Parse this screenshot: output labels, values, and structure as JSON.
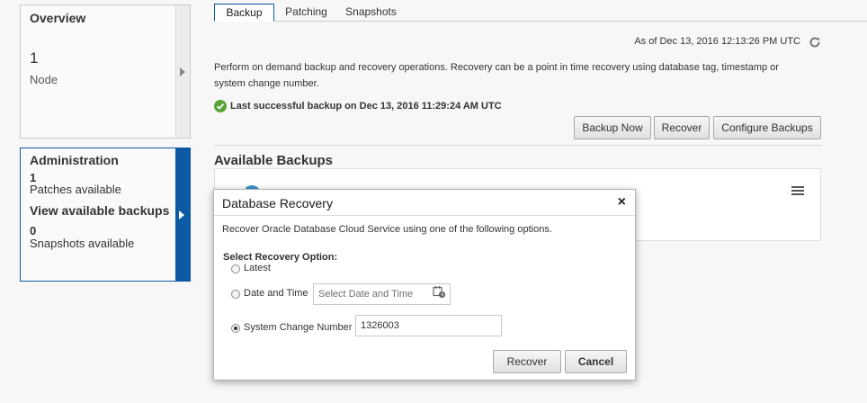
{
  "overview": {
    "title": "Overview",
    "count": "1",
    "label": "Node"
  },
  "admin": {
    "title": "Administration",
    "patches_count": "1",
    "patches_label": "Patches available",
    "backups_link": "View available backups",
    "snapshots_count": "0",
    "snapshots_label": "Snapshots available"
  },
  "tabs": [
    "Backup",
    "Patching",
    "Snapshots"
  ],
  "as_of": "As of Dec 13, 2016 12:13:26 PM UTC",
  "description": "Perform on demand backup and recovery operations. Recovery can be a point in time recovery using database tag, timestamp or system change number.",
  "last_backup": "Last successful backup on Dec 13, 2016 11:29:24 AM UTC",
  "actions": {
    "backup_now": "Backup Now",
    "recover": "Recover",
    "configure": "Configure Backups"
  },
  "available_backups_title": "Available Backups",
  "dialog": {
    "title": "Database Recovery",
    "close": "×",
    "intro": "Recover Oracle Database Cloud Service using one of the following options.",
    "select_label": "Select Recovery Option:",
    "options": {
      "latest": "Latest",
      "date_time": "Date and Time",
      "scn": "System Change Number"
    },
    "date_placeholder": "Select Date and Time",
    "scn_value": "1326003",
    "selected_option": "System Change Number",
    "recover_button": "Recover",
    "cancel_button": "Cancel"
  },
  "colors": {
    "accent": "#0b5aa3",
    "success": "#5aa339"
  }
}
